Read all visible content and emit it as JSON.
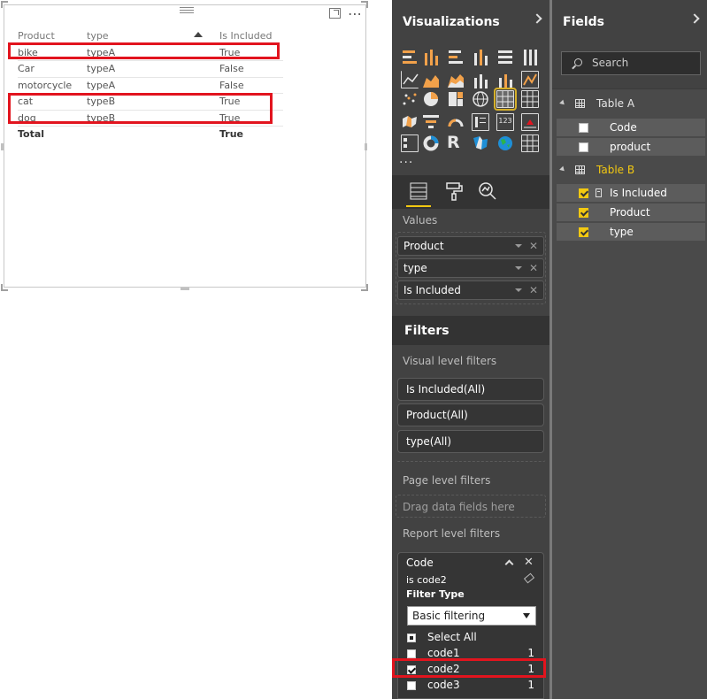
{
  "table": {
    "headers": [
      "Product",
      "type",
      "Is Included"
    ],
    "rows": [
      [
        "bike",
        "typeA",
        "True"
      ],
      [
        "Car",
        "typeA",
        "False"
      ],
      [
        "motorcycle",
        "typeA",
        "False"
      ],
      [
        "cat",
        "typeB",
        "True"
      ],
      [
        "dog",
        "typeB",
        "True"
      ]
    ],
    "total": [
      "Total",
      "",
      "True"
    ]
  },
  "visualizations": {
    "title": "Visualizations",
    "more_label": "...",
    "values_label": "Values",
    "wells": [
      "Product",
      "type",
      "Is Included"
    ]
  },
  "filters": {
    "title": "Filters",
    "visual_level_label": "Visual level filters",
    "visual_level": [
      "Is Included(All)",
      "Product(All)",
      "type(All)"
    ],
    "page_level_label": "Page level filters",
    "drag_text": "Drag data fields here",
    "report_level_label": "Report level filters",
    "code_card": {
      "title": "Code",
      "subtitle": "is code2",
      "filter_type_label": "Filter Type",
      "filter_type_value": "Basic filtering",
      "select_all": "Select All",
      "options": [
        {
          "label": "code1",
          "count": "1",
          "checked": false
        },
        {
          "label": "code2",
          "count": "1",
          "checked": true
        },
        {
          "label": "code3",
          "count": "1",
          "checked": false
        }
      ]
    }
  },
  "fields": {
    "title": "Fields",
    "search_placeholder": "Search",
    "tables": [
      {
        "name": "Table A",
        "fields": [
          {
            "name": "Code",
            "checked": false
          },
          {
            "name": "product",
            "checked": false
          }
        ]
      },
      {
        "name": "Table B",
        "fields": [
          {
            "name": "Is Included",
            "checked": true,
            "calculated": true
          },
          {
            "name": "Product",
            "checked": true
          },
          {
            "name": "type",
            "checked": true
          }
        ]
      }
    ]
  },
  "colors": {
    "accent": "#f2c811",
    "highlight": "#e2141e",
    "pane_bg": "#424242"
  }
}
